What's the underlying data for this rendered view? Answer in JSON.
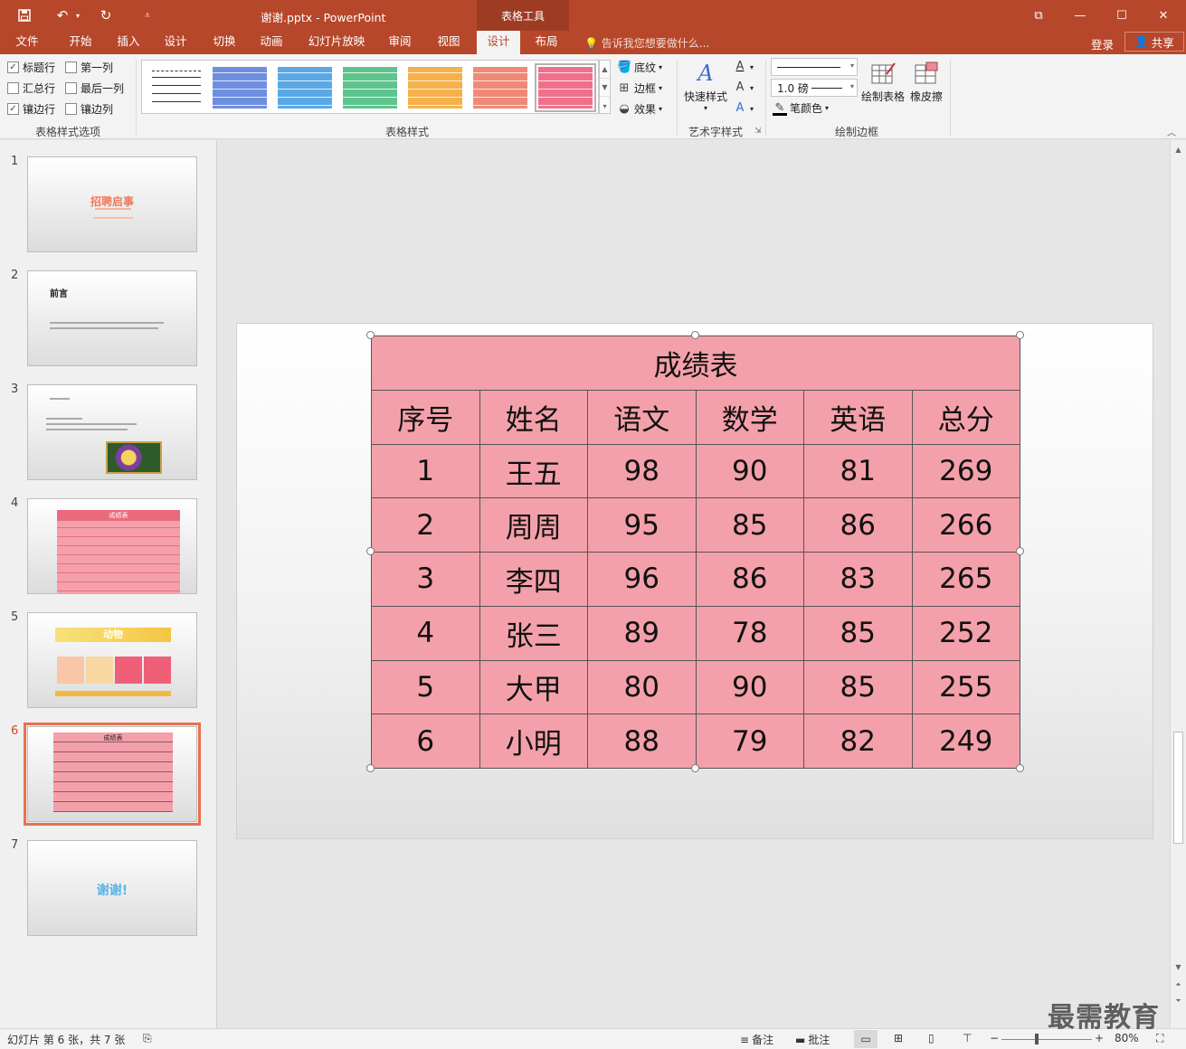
{
  "titlebar": {
    "doc_title": "谢谢.pptx - PowerPoint",
    "context_tool": "表格工具",
    "icons": [
      "save-icon",
      "undo-icon",
      "redo-icon",
      "customize-qat-icon"
    ]
  },
  "tabs": [
    "文件",
    "开始",
    "插入",
    "设计",
    "切换",
    "动画",
    "幻灯片放映",
    "审阅",
    "视图",
    "设计",
    "布局"
  ],
  "active_tab_index": 9,
  "tellme_placeholder": "告诉我您想要做什么...",
  "login": "登录",
  "share": "共享",
  "ribbon": {
    "options": {
      "header_row": "标题行",
      "first_column": "第一列",
      "total_row": "汇总行",
      "last_column": "最后一列",
      "banded_rows": "镶边行",
      "banded_columns": "镶边列",
      "group_label": "表格样式选项"
    },
    "styles": {
      "group_label": "表格样式",
      "shading": "底纹",
      "borders": "边框",
      "effects": "效果",
      "swatch_colors": [
        "#ffffff",
        "#6f8fe0",
        "#5aa9e6",
        "#5ec48e",
        "#f6b14c",
        "#f08a78",
        "#f0708a"
      ]
    },
    "wordart": {
      "quick_styles": "快速样式",
      "group_label": "艺术字样式"
    },
    "draw_borders": {
      "pen_weight": "1.0 磅",
      "pen_color": "笔颜色",
      "draw_table": "绘制表格",
      "eraser": "橡皮擦",
      "group_label": "绘制边框"
    }
  },
  "thumbnails": [
    {
      "num": "1",
      "title": "招聘启事"
    },
    {
      "num": "2",
      "title": "前言"
    },
    {
      "num": "3",
      "title": ""
    },
    {
      "num": "4",
      "title": "成绩表"
    },
    {
      "num": "5",
      "title": "动物"
    },
    {
      "num": "6",
      "title": "成绩表"
    },
    {
      "num": "7",
      "title": "谢谢!"
    }
  ],
  "selected_slide": 6,
  "slide_table": {
    "title": "成绩表",
    "headers": [
      "序号",
      "姓名",
      "语文",
      "数学",
      "英语",
      "总分"
    ],
    "rows": [
      [
        "1",
        "王五",
        "98",
        "90",
        "81",
        "269"
      ],
      [
        "2",
        "周周",
        "95",
        "85",
        "86",
        "266"
      ],
      [
        "3",
        "李四",
        "96",
        "86",
        "83",
        "265"
      ],
      [
        "4",
        "张三",
        "89",
        "78",
        "85",
        "252"
      ],
      [
        "5",
        "大甲",
        "80",
        "90",
        "85",
        "255"
      ],
      [
        "6",
        "小明",
        "88",
        "79",
        "82",
        "249"
      ]
    ],
    "fill_color": "#f4a0aa"
  },
  "statusbar": {
    "slide_info": "幻灯片 第 6 张，共 7 张",
    "notes": "备注",
    "comments": "批注",
    "zoom": "80%"
  },
  "watermark": "最需教育"
}
